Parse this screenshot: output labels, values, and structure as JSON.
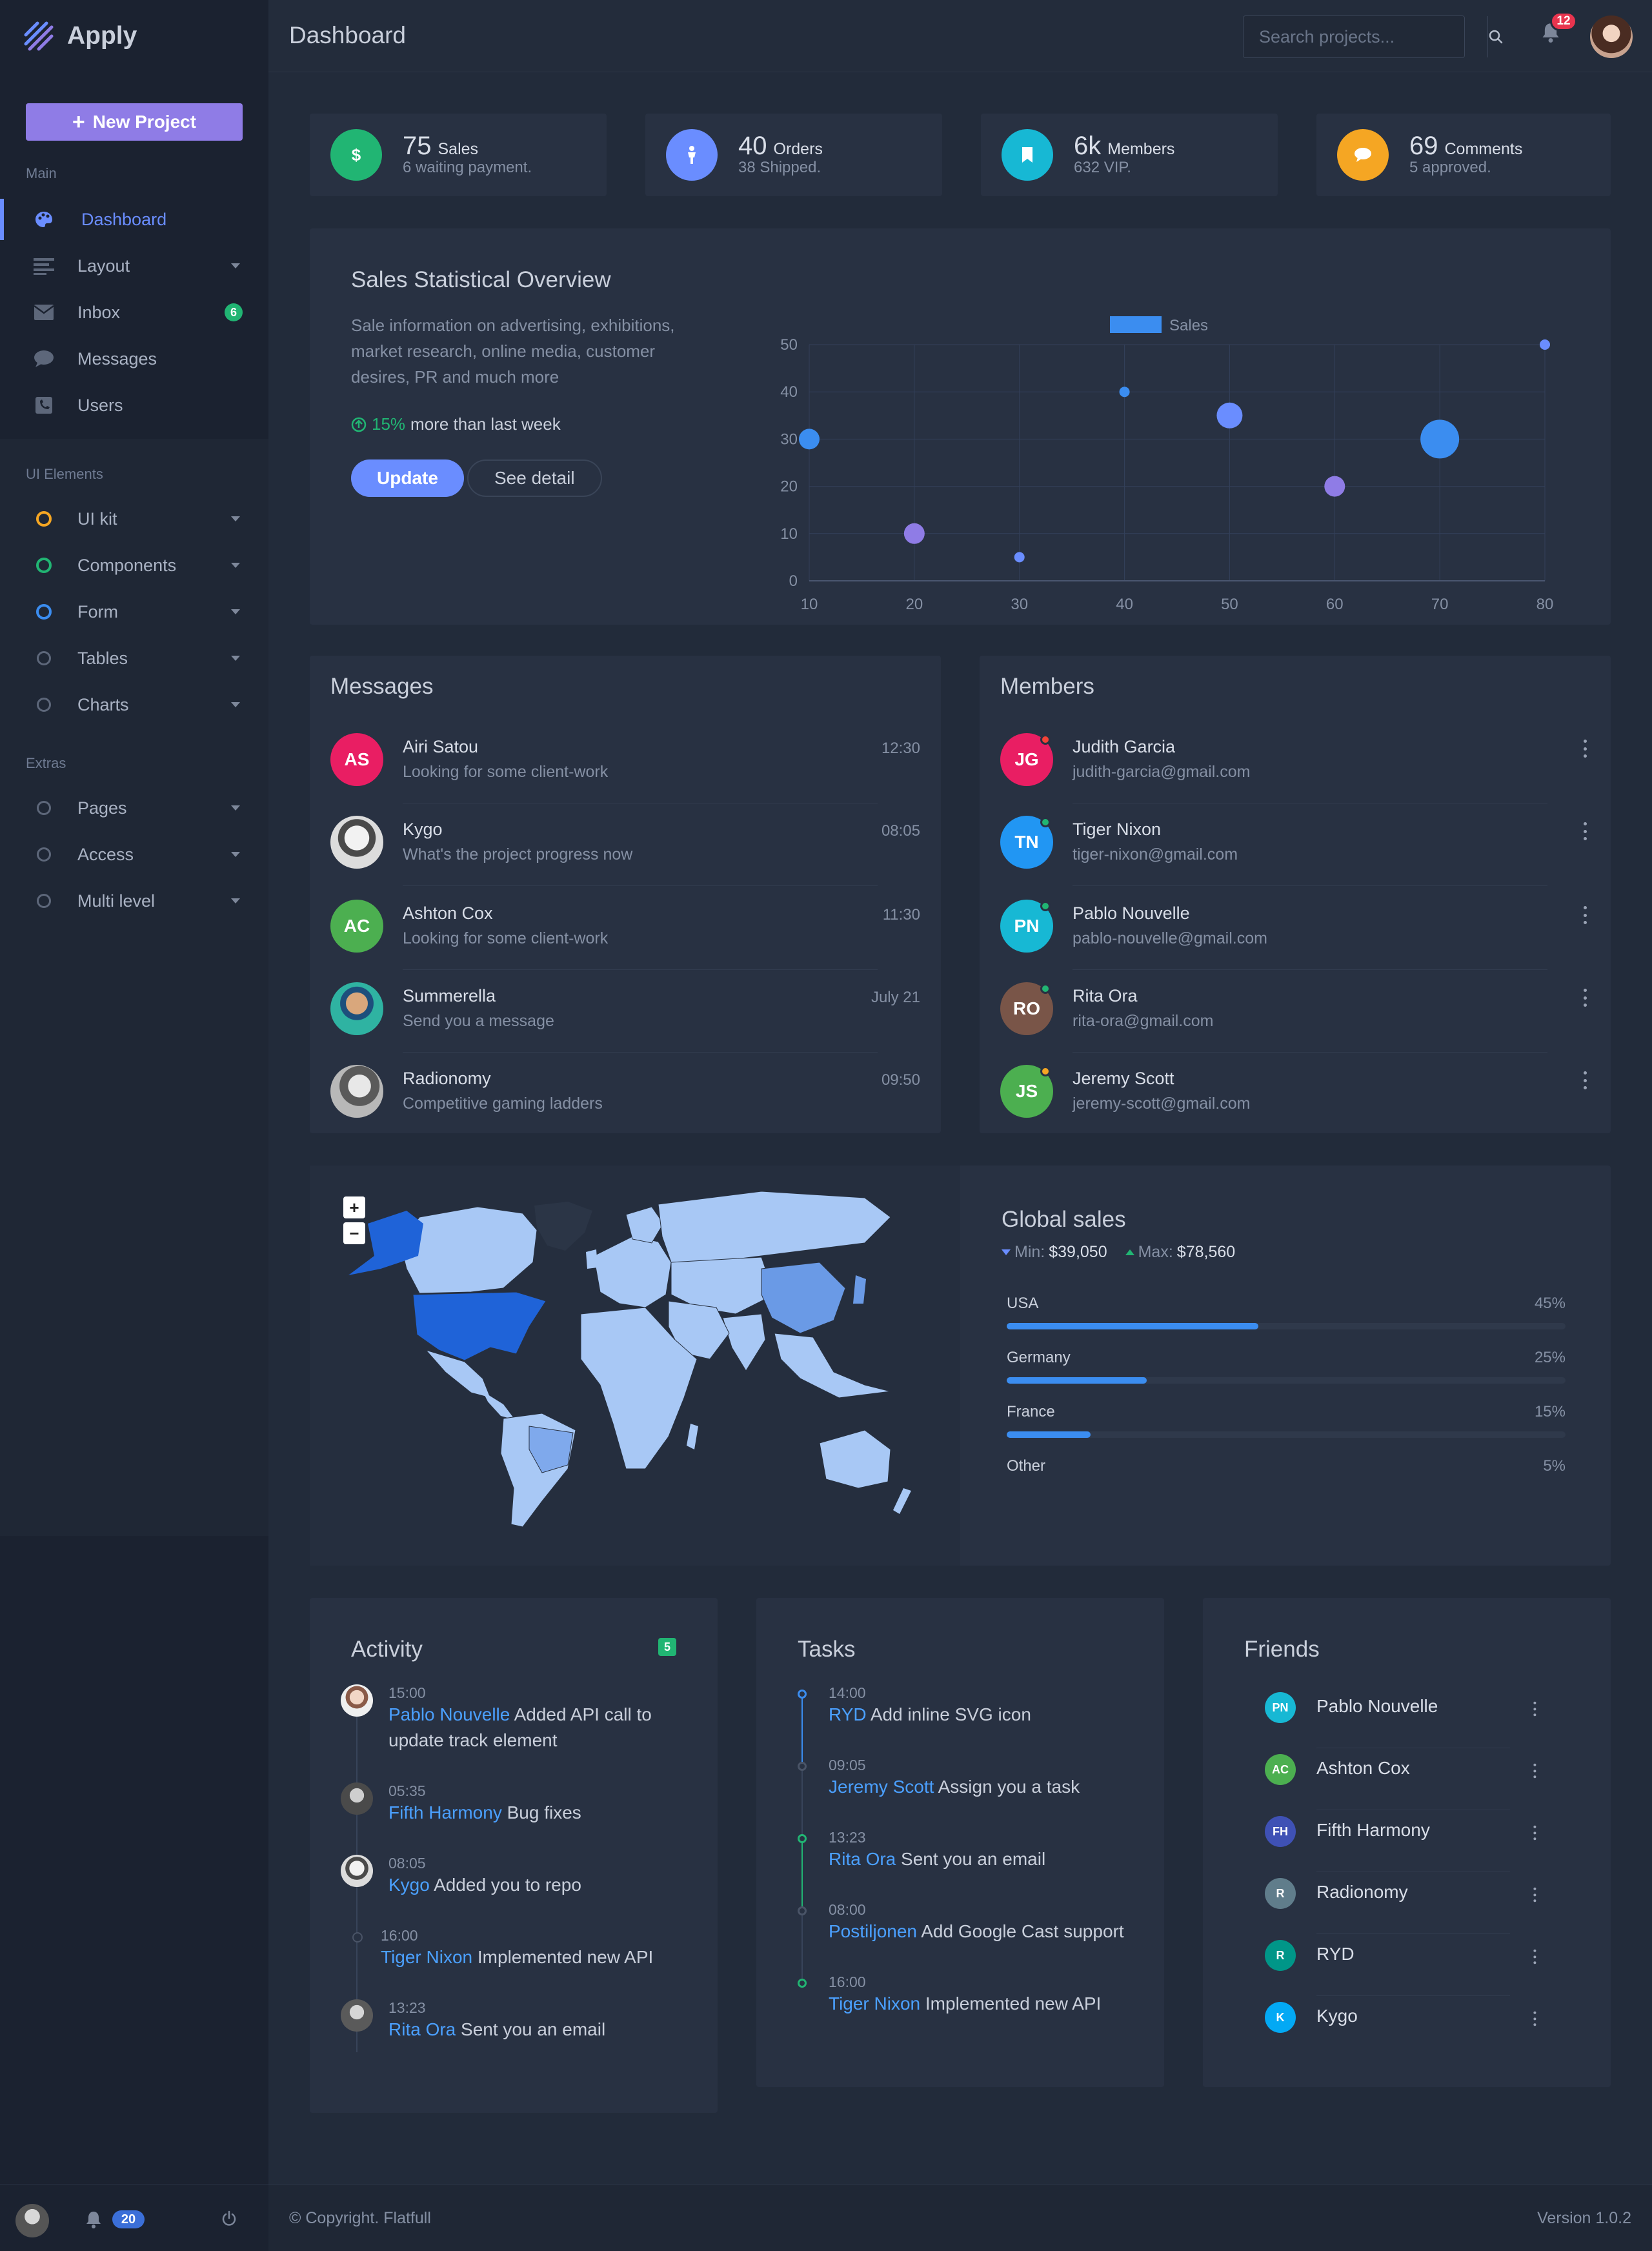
{
  "brand": {
    "name": "Apply"
  },
  "header": {
    "title": "Dashboard",
    "search_placeholder": "Search projects...",
    "notification_count": "12"
  },
  "sidebar": {
    "new_project": "New Project",
    "sections": {
      "main": "Main",
      "ui_elements": "UI Elements",
      "extras": "Extras"
    },
    "main_items": [
      {
        "label": "Dashboard",
        "icon": "palette-icon",
        "active": true
      },
      {
        "label": "Layout",
        "icon": "layout-lines-icon",
        "has_submenu": true
      },
      {
        "label": "Inbox",
        "icon": "inbox-icon",
        "badge": "6"
      },
      {
        "label": "Messages",
        "icon": "chat-icon"
      },
      {
        "label": "Users",
        "icon": "contact-icon"
      }
    ],
    "ui_items": [
      {
        "label": "UI kit",
        "ring_color": "#f5a623"
      },
      {
        "label": "Components",
        "ring_color": "#21b573"
      },
      {
        "label": "Form",
        "ring_color": "#3b8df0"
      },
      {
        "label": "Tables",
        "ring_color": "#5d677a"
      },
      {
        "label": "Charts",
        "ring_color": "#5d677a"
      }
    ],
    "extras_items": [
      {
        "label": "Pages"
      },
      {
        "label": "Access"
      },
      {
        "label": "Multi level"
      }
    ],
    "footer": {
      "notification_count": "20"
    }
  },
  "stats": [
    {
      "value": "75",
      "label": "Sales",
      "sub": "6 waiting payment.",
      "color": "#21b573",
      "icon": "dollar-icon"
    },
    {
      "value": "40",
      "label": "Orders",
      "sub": "38 Shipped.",
      "color": "#6a8dff",
      "icon": "person-icon"
    },
    {
      "value": "6k",
      "label": "Members",
      "sub": "632 VIP.",
      "color": "#17b8d4",
      "icon": "bookmark-icon"
    },
    {
      "value": "69",
      "label": "Comments",
      "sub": "5 approved.",
      "color": "#f5a623",
      "icon": "comment-icon"
    }
  ],
  "overview": {
    "title": "Sales Statistical Overview",
    "description": "Sale information on advertising, exhibitions, market research, online media, customer desires, PR and much more",
    "trend_value": "15%",
    "trend_text": "more than last week",
    "update_label": "Update",
    "detail_label": "See detail"
  },
  "chart_data": {
    "type": "scatter",
    "legend": "Sales",
    "legend_position": "top",
    "xlim": [
      10,
      80
    ],
    "ylim": [
      0,
      50
    ],
    "x_ticks": [
      10,
      20,
      30,
      40,
      50,
      60,
      70,
      80
    ],
    "y_ticks": [
      0,
      10,
      20,
      30,
      40,
      50
    ],
    "grid": true,
    "points": [
      {
        "x": 10,
        "y": 30,
        "size": "medium",
        "color": "#3b8df0"
      },
      {
        "x": 20,
        "y": 10,
        "size": "medium",
        "color": "#8f7ce6"
      },
      {
        "x": 30,
        "y": 5,
        "size": "small",
        "color": "#6a8dff"
      },
      {
        "x": 40,
        "y": 40,
        "size": "small",
        "color": "#3b8df0"
      },
      {
        "x": 50,
        "y": 35,
        "size": "large",
        "color": "#6a8dff"
      },
      {
        "x": 60,
        "y": 20,
        "size": "medium",
        "color": "#8f7ce6"
      },
      {
        "x": 70,
        "y": 30,
        "size": "xlarge",
        "color": "#3b8df0"
      },
      {
        "x": 80,
        "y": 50,
        "size": "small",
        "color": "#6a8dff"
      }
    ]
  },
  "messages": {
    "title": "Messages",
    "items": [
      {
        "initials": "AS",
        "name": "Airi Satou",
        "text": "Looking for some client-work",
        "time": "12:30",
        "color": "#e91e63"
      },
      {
        "initials": "",
        "name": "Kygo",
        "text": "What's the project progress now",
        "time": "08:05",
        "color": "#b9bec7"
      },
      {
        "initials": "AC",
        "name": "Ashton Cox",
        "text": "Looking for some client-work",
        "time": "11:30",
        "color": "#4caf50"
      },
      {
        "initials": "",
        "name": "Summerella",
        "text": "Send you a message",
        "time": "July 21",
        "color": "#2d9c8a"
      },
      {
        "initials": "",
        "name": "Radionomy",
        "text": "Competitive gaming ladders",
        "time": "09:50",
        "color": "#8d8d8d"
      }
    ]
  },
  "members": {
    "title": "Members",
    "items": [
      {
        "initials": "JG",
        "name": "Judith Garcia",
        "email": "judith-garcia@gmail.com",
        "color": "#e91e63",
        "status": "#f44336"
      },
      {
        "initials": "TN",
        "name": "Tiger Nixon",
        "email": "tiger-nixon@gmail.com",
        "color": "#2196f3",
        "status": "#21b573"
      },
      {
        "initials": "PN",
        "name": "Pablo Nouvelle",
        "email": "pablo-nouvelle@gmail.com",
        "color": "#17b8d4",
        "status": "#21b573"
      },
      {
        "initials": "RO",
        "name": "Rita Ora",
        "email": "rita-ora@gmail.com",
        "color": "#795548",
        "status": "#21b573"
      },
      {
        "initials": "JS",
        "name": "Jeremy Scott",
        "email": "jeremy-scott@gmail.com",
        "color": "#4caf50",
        "status": "#f5a623"
      }
    ]
  },
  "map": {
    "zoom_in": "+",
    "zoom_out": "−"
  },
  "global_sales": {
    "title": "Global sales",
    "min_label": "Min:",
    "min_value": "$39,050",
    "max_label": "Max:",
    "max_value": "$78,560",
    "bars": [
      {
        "label": "USA",
        "pct": "45%",
        "value": 45
      },
      {
        "label": "Germany",
        "pct": "25%",
        "value": 25
      },
      {
        "label": "France",
        "pct": "15%",
        "value": 15
      },
      {
        "label": "Other",
        "pct": "5%",
        "value": 5
      }
    ]
  },
  "activity": {
    "title": "Activity",
    "badge": "5",
    "items": [
      {
        "time": "15:00",
        "who": "Pablo Nouvelle",
        "text": "Added API call to update track element",
        "avatar": true
      },
      {
        "time": "05:35",
        "who": "Fifth Harmony",
        "text": "Bug fixes",
        "avatar": true
      },
      {
        "time": "08:05",
        "who": "Kygo",
        "text": "Added you to repo",
        "avatar": true
      },
      {
        "time": "16:00",
        "who": "Tiger Nixon",
        "text": "Implemented new API",
        "avatar": false
      },
      {
        "time": "13:23",
        "who": "Rita Ora",
        "text": "Sent you an email",
        "avatar": true
      }
    ]
  },
  "tasks": {
    "title": "Tasks",
    "items": [
      {
        "time": "14:00",
        "who": "RYD",
        "text": "Add inline SVG icon",
        "color": "#3b8df0"
      },
      {
        "time": "09:05",
        "who": "Jeremy Scott",
        "text": "Assign you a task",
        "color": "#4a5467"
      },
      {
        "time": "13:23",
        "who": "Rita Ora",
        "text": "Sent you an email",
        "color": "#21b573"
      },
      {
        "time": "08:00",
        "who": "Postiljonen",
        "text": "Add Google Cast support",
        "color": "#4a5467"
      },
      {
        "time": "16:00",
        "who": "Tiger Nixon",
        "text": "Implemented new API",
        "color": "#21b573"
      }
    ]
  },
  "friends": {
    "title": "Friends",
    "items": [
      {
        "initials": "PN",
        "name": "Pablo Nouvelle",
        "color": "#17b8d4"
      },
      {
        "initials": "AC",
        "name": "Ashton Cox",
        "color": "#4caf50"
      },
      {
        "initials": "FH",
        "name": "Fifth Harmony",
        "color": "#3f51b5"
      },
      {
        "initials": "R",
        "name": "Radionomy",
        "color": "#607d8b"
      },
      {
        "initials": "R",
        "name": "RYD",
        "color": "#009688"
      },
      {
        "initials": "K",
        "name": "Kygo",
        "color": "#03a9f4"
      }
    ]
  },
  "footer": {
    "copyright": "© Copyright. Flatfull",
    "version": "Version 1.0.2"
  }
}
